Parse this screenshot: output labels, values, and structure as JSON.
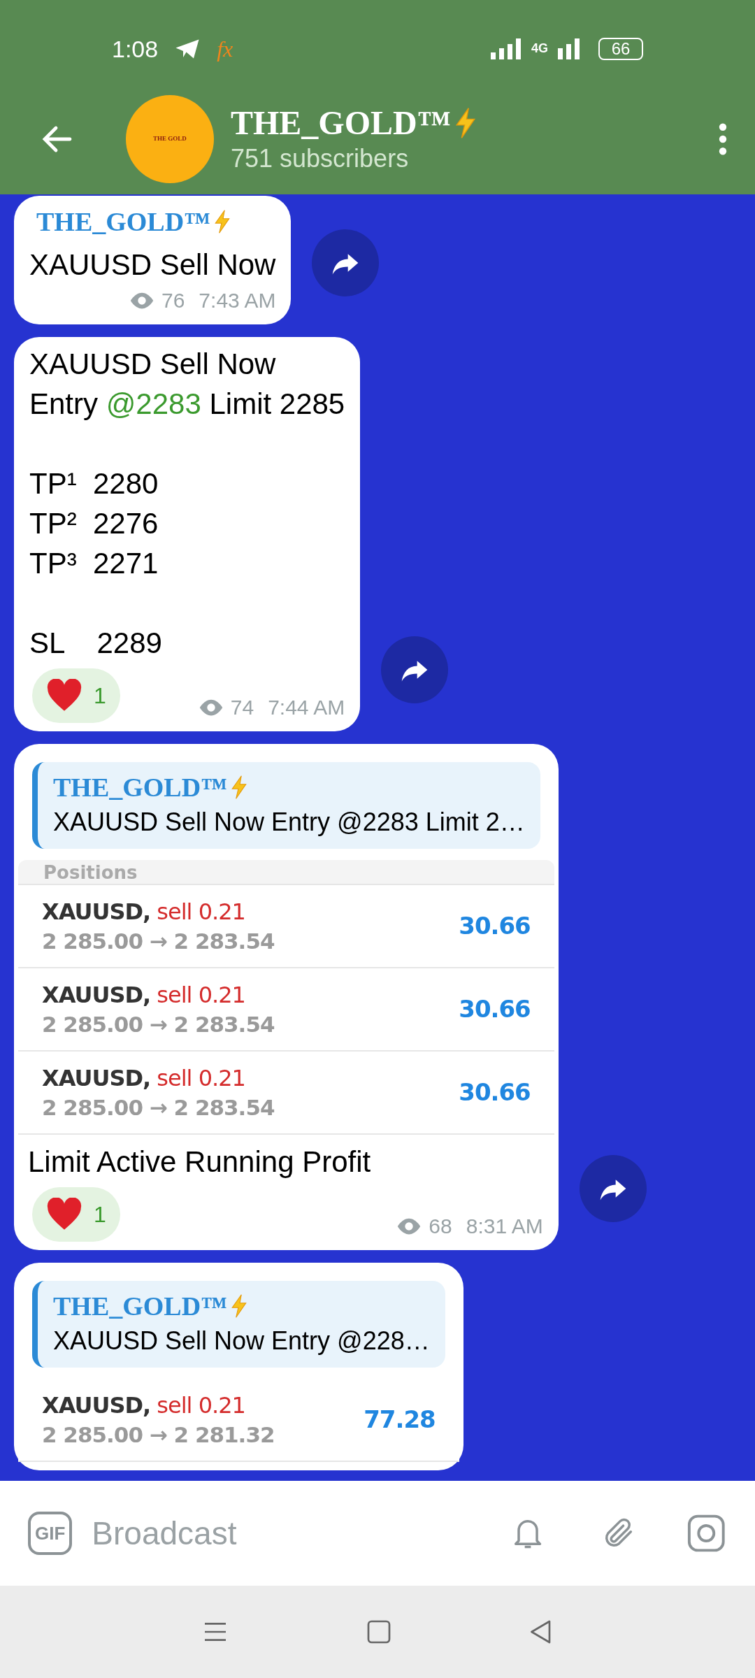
{
  "status_bar": {
    "time": "1:08",
    "app_label": "fx",
    "network": "4G",
    "battery": "66"
  },
  "header": {
    "avatar_text": "THE GOLD",
    "title": "THE_GOLD™",
    "subtitle": "751 subscribers"
  },
  "messages": [
    {
      "author": "THE_GOLD™",
      "paragraphs": [
        [
          [
            {
              "text": "XAUUSD Sell Now"
            }
          ]
        ]
      ],
      "views": "76",
      "time": "7:43 AM"
    },
    {
      "paragraphs": [
        [
          [
            {
              "text": "XAUUSD Sell Now"
            }
          ],
          [
            {
              "text": "Entry "
            },
            {
              "text": "@2283",
              "kind": "mention"
            },
            {
              "text": " Limit 2285"
            }
          ]
        ],
        [
          [
            {
              "text": "TP¹  2280"
            }
          ],
          [
            {
              "text": "TP²  2276"
            }
          ],
          [
            {
              "text": "TP³  2271"
            }
          ]
        ],
        [
          [
            {
              "text": "SL    2289"
            }
          ]
        ]
      ],
      "reactions": [
        {
          "count": "1"
        }
      ],
      "views": "74",
      "time": "7:44 AM"
    },
    {
      "reply": {
        "author": "THE_GOLD™",
        "text": "XAUUSD Sell Now Entry @2283 Limit 2…"
      },
      "screenshot": {
        "header": "Positions",
        "positions": [
          {
            "symbol": "XAUUSD,",
            "side": "sell 0.21",
            "prices": "2 285.00 → 2 283.54",
            "profit": "30.66"
          },
          {
            "symbol": "XAUUSD,",
            "side": "sell 0.21",
            "prices": "2 285.00 → 2 283.54",
            "profit": "30.66"
          },
          {
            "symbol": "XAUUSD,",
            "side": "sell 0.21",
            "prices": "2 285.00 → 2 283.54",
            "profit": "30.66"
          }
        ]
      },
      "paragraphs": [
        [
          [
            {
              "text": "Limit Active Running Profit"
            }
          ]
        ]
      ],
      "reactions": [
        {
          "count": "1"
        }
      ],
      "views": "68",
      "time": "8:31 AM"
    },
    {
      "reply": {
        "author": "THE_GOLD™",
        "text": "XAUUSD Sell Now Entry @228…"
      },
      "screenshot": {
        "positions": [
          {
            "symbol": "XAUUSD,",
            "side": "sell 0.21",
            "prices": "2 285.00 → 2 281.32",
            "profit": "77.28"
          }
        ]
      }
    }
  ],
  "composer": {
    "gif_label": "GIF",
    "placeholder": "Broadcast"
  }
}
